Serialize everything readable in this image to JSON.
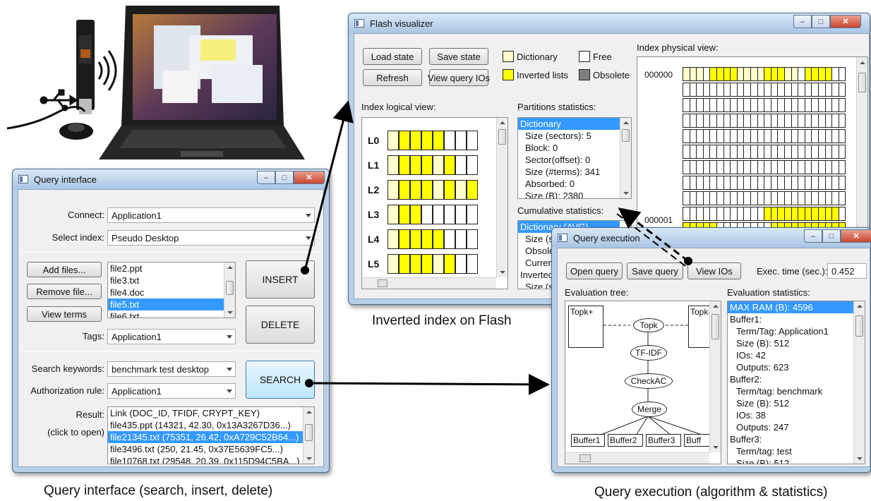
{
  "query_interface": {
    "title": "Query interface",
    "connect_label": "Connect:",
    "connect_value": "Application1",
    "select_index_label": "Select index:",
    "select_index_value": "Pseudo Desktop",
    "add_files": "Add files...",
    "remove_file": "Remove file...",
    "view_terms": "View terms",
    "files": [
      "file2.ppt",
      "file3.txt",
      "file4.doc",
      "file5.txt",
      "file6.txt"
    ],
    "insert": "INSERT",
    "delete": "DELETE",
    "tags_label": "Tags:",
    "tags_value": "Application1",
    "search_keywords_label": "Search keywords:",
    "search_keywords_value": "benchmark test desktop",
    "auth_rule_label": "Authorization rule:",
    "auth_rule_value": "Application1",
    "search": "SEARCH",
    "result_label": "Result:",
    "result_hint": "(click to open)",
    "results": [
      "Link  (DOC_ID, TFIDF, CRYPT_KEY)",
      "file435.ppt  (14321, 42.30, 0x13A3267D36...)",
      "file21345.txt  (75351, 26.42, 0xA729C52B64...)",
      "file3496.txt  (250, 21.45, 0x37E5639FC5...)",
      "file10768.txt  (29548, 20.39, 0x115D94C5BA...)"
    ]
  },
  "flash": {
    "title": "Flash visualizer",
    "load_state": "Load state",
    "save_state": "Save state",
    "refresh": "Refresh",
    "view_query_ios": "View query IOs",
    "legend_dictionary": "Dictionary",
    "legend_free": "Free",
    "legend_inverted": "Inverted lists",
    "legend_obsolete": "Obsolete",
    "index_logical_view": "Index logical view:",
    "levels": [
      "L0",
      "L1",
      "L2",
      "L3",
      "L4",
      "L5"
    ],
    "partitions_statistics": "Partitions statistics:",
    "partitions": [
      "Dictionary",
      "Size (sectors): 5",
      "Block: 0",
      "Sector(offset): 0",
      "Size (#terms): 341",
      "Absorbed: 0",
      "Size (B): 2380"
    ],
    "cumulative_statistics": "Cumulative statistics:",
    "cumulative": [
      "Dictionary (AVG)",
      "Size (se",
      "Obsole",
      "Curren",
      "Inverted",
      "Size (se"
    ],
    "index_physical_view": "Index physical view:",
    "block_ids": [
      "000000",
      "000001"
    ]
  },
  "query_exec": {
    "title": "Query execution",
    "open_query": "Open query",
    "save_query": "Save query",
    "view_ios": "View IOs",
    "exec_time_label": "Exec. time (sec.):",
    "exec_time_value": "0.452",
    "evaluation_tree": "Evaluation tree:",
    "evaluation_statistics": "Evaluation statistics:",
    "nodes": {
      "topk_left": "Topk+",
      "topk_right": "Topk-",
      "topk": "Topk",
      "tfidf": "TF-IDF",
      "checkac": "CheckAC",
      "merge": "Merge"
    },
    "buffers": [
      "Buffer1",
      "Buffer2",
      "Buffer3",
      "Buff"
    ],
    "stats": [
      "MAX RAM (B): 4596",
      "Buffer1:",
      "Term/Tag: Application1",
      "Size (B): 512",
      "IOs: 42",
      "Outputs: 623",
      "Buffer2:",
      "Term/tag: benchmark",
      "Size (B): 512",
      "IOs: 38",
      "Outputs: 247",
      "Buffer3:",
      "Term/tag: test",
      "Size (B): 512"
    ]
  },
  "captions": {
    "query_interface": "Query interface (search, insert, delete)",
    "inverted_index": "Inverted index on Flash",
    "query_execution": "Query execution (algorithm & statistics)"
  },
  "colors": {
    "dictionary": "#ffffcc",
    "inverted": "#ffff00",
    "obsolete": "#7f7f7f",
    "selection": "#3399ff"
  }
}
